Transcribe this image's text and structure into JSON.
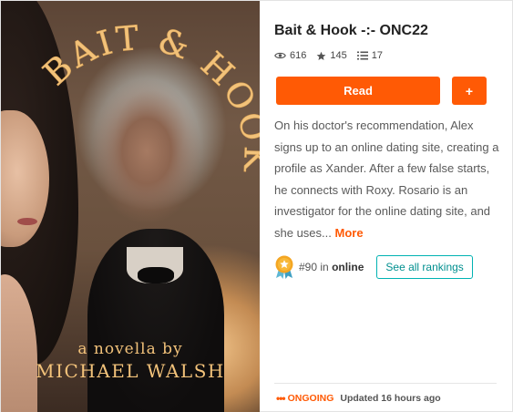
{
  "cover": {
    "title": "BAIT & HOOK",
    "byline": "a novella by",
    "author": "MICHAEL WALSH"
  },
  "story": {
    "title": "Bait & Hook -:- ONC22",
    "reads": "616",
    "votes": "145",
    "parts": "17",
    "description": "On his doctor's recommendation, Alex signs up to an online dating site, creating a profile as Xander. After a few false starts, he connects with Roxy. Rosario is an investigator for the online dating site, and she uses...",
    "more_label": "More"
  },
  "actions": {
    "read_label": "Read",
    "add_label": "+"
  },
  "ranking": {
    "rank": "#90",
    "in_label": "in",
    "tag": "online",
    "see_all_label": "See all rankings"
  },
  "status": {
    "dots": "•••",
    "state": "ONGOING",
    "updated": "Updated 16 hours ago"
  },
  "icons": {
    "reads": "eye-icon",
    "votes": "star-icon",
    "parts": "list-icon",
    "rank_badge": "medal-icon"
  },
  "colors": {
    "accent": "#ff5a05",
    "teal": "#00b2b2",
    "cover_text": "#f2c27a"
  }
}
